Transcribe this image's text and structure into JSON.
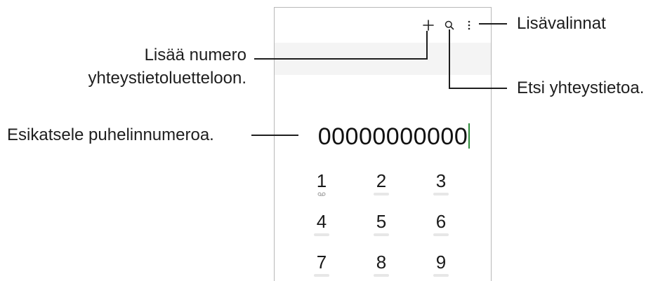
{
  "phone": {
    "toolbar": {
      "add_icon": "plus-icon",
      "search_icon": "search-icon",
      "more_icon": "more-vertical-icon"
    },
    "dialed_number": "00000000000",
    "keypad": [
      {
        "digit": "1",
        "sub": "voicemail-icon"
      },
      {
        "digit": "2",
        "sub": ""
      },
      {
        "digit": "3",
        "sub": ""
      },
      {
        "digit": "4",
        "sub": ""
      },
      {
        "digit": "5",
        "sub": ""
      },
      {
        "digit": "6",
        "sub": ""
      },
      {
        "digit": "7",
        "sub": ""
      },
      {
        "digit": "8",
        "sub": ""
      },
      {
        "digit": "9",
        "sub": ""
      }
    ]
  },
  "callouts": {
    "more_options": "Lisävalinnat",
    "add_number_line1": "Lisää numero",
    "add_number_line2": "yhteystietoluetteloon.",
    "search_contact": "Etsi yhteystietoa.",
    "preview_number": "Esikatsele puhelinnumeroa."
  },
  "colors": {
    "line": "#1e1e1e",
    "caret": "#2e8b3a",
    "frame": "#b8b8b8"
  }
}
